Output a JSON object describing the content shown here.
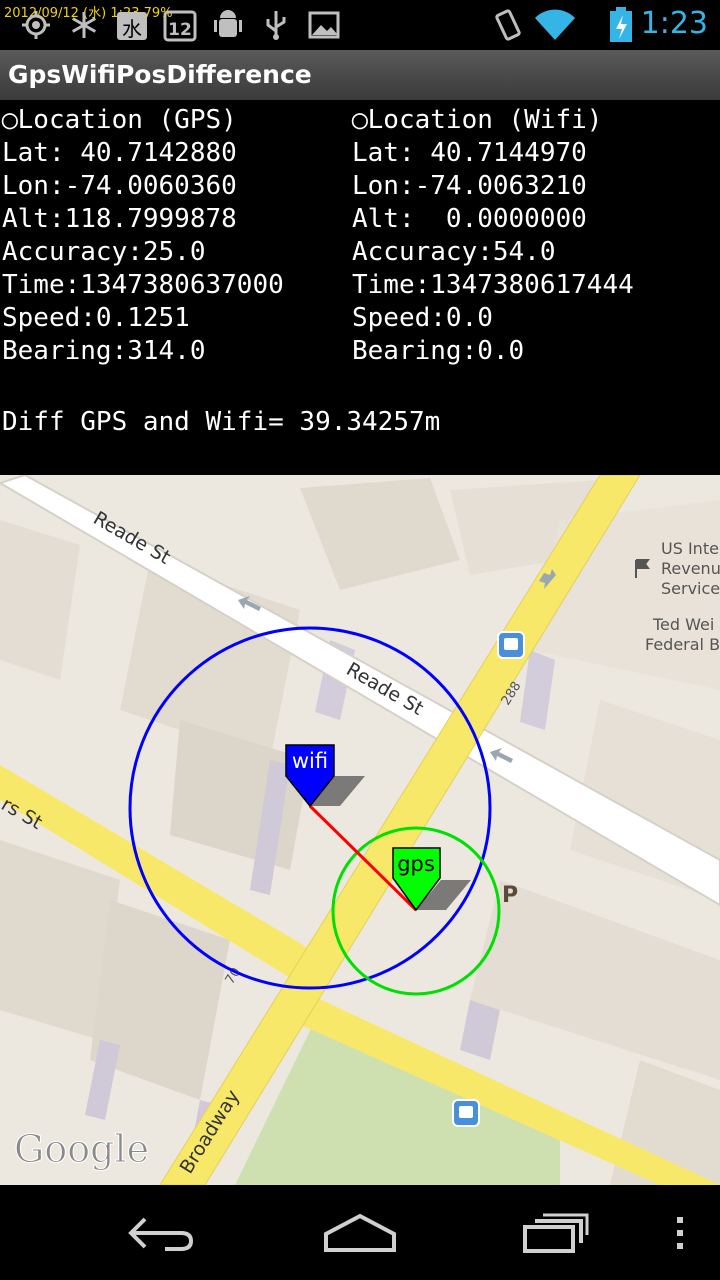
{
  "status_bar": {
    "timestamp": "2012/09/12 (水) 1:23 79%",
    "icons": [
      "gps-icon",
      "snowflake-icon",
      "weekday-calendar-icon",
      "date-calendar-icon",
      "android-debug-icon",
      "usb-icon",
      "image-icon",
      "vibrate-icon",
      "wifi-icon",
      "battery-icon"
    ],
    "calendar_weekday": "水",
    "calendar_day": "12",
    "clock": "1:23"
  },
  "app": {
    "title": "GpsWifiPosDifference"
  },
  "gps": {
    "header": "◯Location (GPS)",
    "lat": "Lat: 40.7142880",
    "lon": "Lon:-74.0060360",
    "alt": "Alt:118.7999878",
    "accuracy": "Accuracy:25.0",
    "time": "Time:1347380637000",
    "speed": "Speed:0.1251",
    "bearing": "Bearing:314.0"
  },
  "wifi": {
    "header": "◯Location (Wifi)",
    "lat": "Lat: 40.7144970",
    "lon": "Lon:-74.0063210",
    "alt": "Alt:  0.0000000",
    "accuracy": "Accuracy:54.0",
    "time": "Time:1347380617444",
    "speed": "Speed:0.0",
    "bearing": "Bearing:0.0"
  },
  "difference": "Diff GPS and Wifi= 39.34257m",
  "map": {
    "street_labels": [
      "Reade St",
      "Reade St",
      "Broadway",
      "rs St",
      "288",
      "70"
    ],
    "poi_labels": [
      "US Inte",
      "Revenu",
      "Service",
      "Ted Wei",
      "Federal B"
    ],
    "markers": {
      "wifi": "wifi",
      "gps": "gps"
    },
    "parking": "P",
    "logo": "Google",
    "colors": {
      "wifi": "#0000ff",
      "gps": "#00ff00",
      "link_line": "#ff0000",
      "road": "#f8e86a"
    }
  },
  "nav": {
    "back": "back-icon",
    "home": "home-icon",
    "recents": "recents-icon",
    "menu": "menu-icon"
  }
}
